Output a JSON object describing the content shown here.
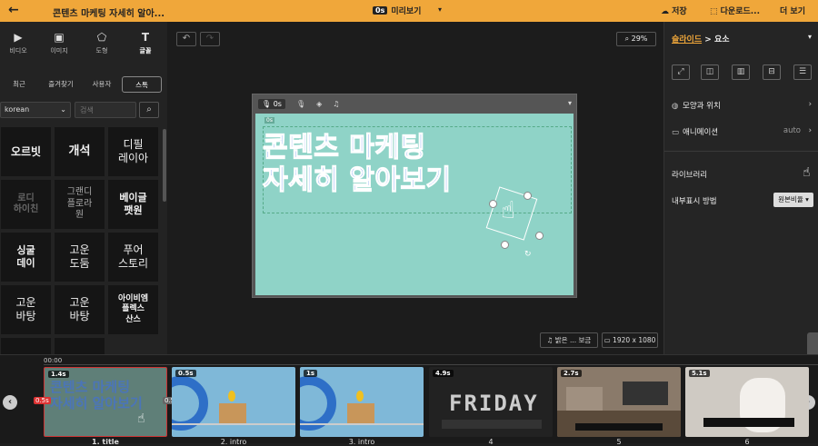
{
  "topbar": {
    "back_icon": "back-arrow-icon",
    "title": "콘텐츠 마케팅 자세히 알아...",
    "preview_badge": "0s",
    "preview_label": "미리보기",
    "save": "저장",
    "download": "다운로드...",
    "more": "더 보기"
  },
  "left_tools": [
    "비디오",
    "이미지",
    "도형",
    "글꼴"
  ],
  "font_tabs": [
    "최근",
    "즐겨찾기",
    "사용자",
    "스톡"
  ],
  "language": "korean",
  "search": {
    "placeholder": "검색"
  },
  "fonts": [
    "오르빗",
    "개석",
    "디필\n레이아",
    "로디\n하이친",
    "그랜디\n플로라\n원",
    "베이글\n팻원",
    "싱굴\n데이",
    "고운\n도둠",
    "푸어\n스토리",
    "고운\n바탕",
    "고운\n바탕",
    "아이비엠\n플렉스\n산스"
  ],
  "canvas": {
    "zoom": "29%",
    "frame_time": "0s",
    "slide_title_1": "콘텐츠 마케팅",
    "slide_title_2": "자세히 알아보기",
    "bg_button": "♫ 밝은 ... 보금",
    "resolution": "1920 x 1080",
    "layer_tag": "0s"
  },
  "right_panel": {
    "breadcrumb_link": "슬라이드",
    "breadcrumb_sep": ">",
    "breadcrumb_current": "요소",
    "shape_position": "모양과 위치",
    "animation": "애니메이션",
    "animation_value": "auto",
    "library": "라이브러리",
    "internal_display": "내부표시 방법",
    "ratio": "원본비율 ▾"
  },
  "timeline": {
    "timecode": "00:00",
    "clips": [
      {
        "duration": "1.4s",
        "label": "1. title",
        "caption": "콘텐츠 마케팅 자세히 알아보기"
      },
      {
        "duration": "0.5s",
        "label": "2. intro",
        "caption": ""
      },
      {
        "duration": "1s",
        "label": "3. intro",
        "caption": ""
      },
      {
        "duration": "4.9s",
        "label": "4",
        "caption": "FRIDAY"
      },
      {
        "duration": "2.7s",
        "label": "5",
        "caption": ""
      },
      {
        "duration": "5.1s",
        "label": "6",
        "caption": ""
      }
    ],
    "marker_red": "0.5s",
    "marker_gray": "0.5s"
  },
  "colors": {
    "accent": "#f0a73a",
    "slide_bg": "#8fd3c7",
    "title_blue": "#2f68e6"
  }
}
